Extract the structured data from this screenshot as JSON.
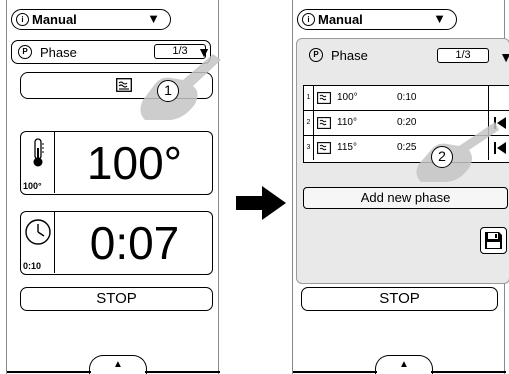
{
  "left_screen": {
    "mode_label": "Manual",
    "mode_icon": "①",
    "phase_label": "Phase",
    "phase_icon": "P",
    "phase_page": "1/3",
    "temperature_value": "100°",
    "temperature_setpoint": "100°",
    "time_value": "0:07",
    "time_setpoint": "0:10",
    "stop_label": "STOP",
    "callout": "1"
  },
  "right_screen": {
    "mode_label": "Manual",
    "mode_icon": "①",
    "phase_label": "Phase",
    "phase_icon": "P",
    "phase_page": "1/3",
    "phases": [
      {
        "num": "1",
        "temp": "100°",
        "time": "0:10"
      },
      {
        "num": "2",
        "temp": "110°",
        "time": "0:20"
      },
      {
        "num": "3",
        "temp": "115°",
        "time": "0:25"
      }
    ],
    "add_phase_label": "Add new phase",
    "stop_label": "STOP",
    "callout": "2"
  },
  "colors": {
    "panel_gray": "#e9e9e9",
    "finger_gray": "#c4c4c4"
  }
}
